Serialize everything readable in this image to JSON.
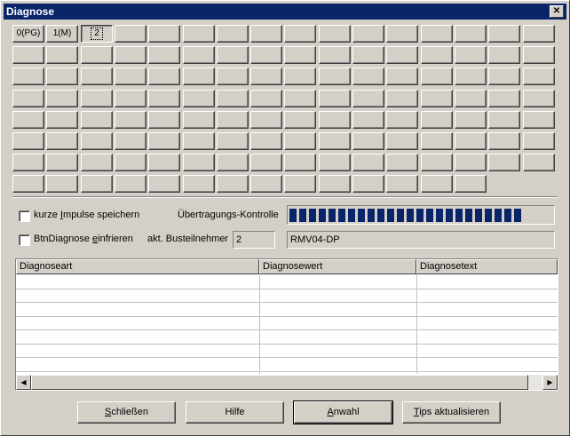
{
  "window": {
    "title": "Diagnose",
    "close_symbol": "✕"
  },
  "grid": {
    "rows": 8,
    "cols": 16,
    "last_row_cells": 14,
    "labeled_cells": [
      {
        "label": "0(PG)"
      },
      {
        "label": "1(M)"
      },
      {
        "label": "2",
        "selected": true
      }
    ]
  },
  "options": {
    "kurze_impulse": {
      "label_before": "kurze ",
      "accel": "I",
      "label_after": "mpulse speichern",
      "checked": false
    },
    "btn_diagnose": {
      "label_before": "BtnDiagnose ",
      "accel": "e",
      "label_after": "infrieren",
      "checked": false
    }
  },
  "transfer": {
    "label": "Übertragungs-Kontrolle",
    "segments": 24
  },
  "bus": {
    "label": "akt. Busteilnehmer",
    "value": "2",
    "device": "RMV04-DP"
  },
  "table": {
    "columns": [
      "Diagnoseart",
      "Diagnosewert",
      "Diagnosetext"
    ],
    "rows": [],
    "scroll_left_symbol": "◀",
    "scroll_right_symbol": "▶"
  },
  "buttons": {
    "close": {
      "before": "",
      "accel": "S",
      "after": "chließen"
    },
    "help": {
      "label": "Hilfe"
    },
    "select": {
      "before": "",
      "accel": "A",
      "after": "nwahl"
    },
    "tips": {
      "before": "",
      "accel": "T",
      "after": "ips aktualisieren"
    }
  }
}
